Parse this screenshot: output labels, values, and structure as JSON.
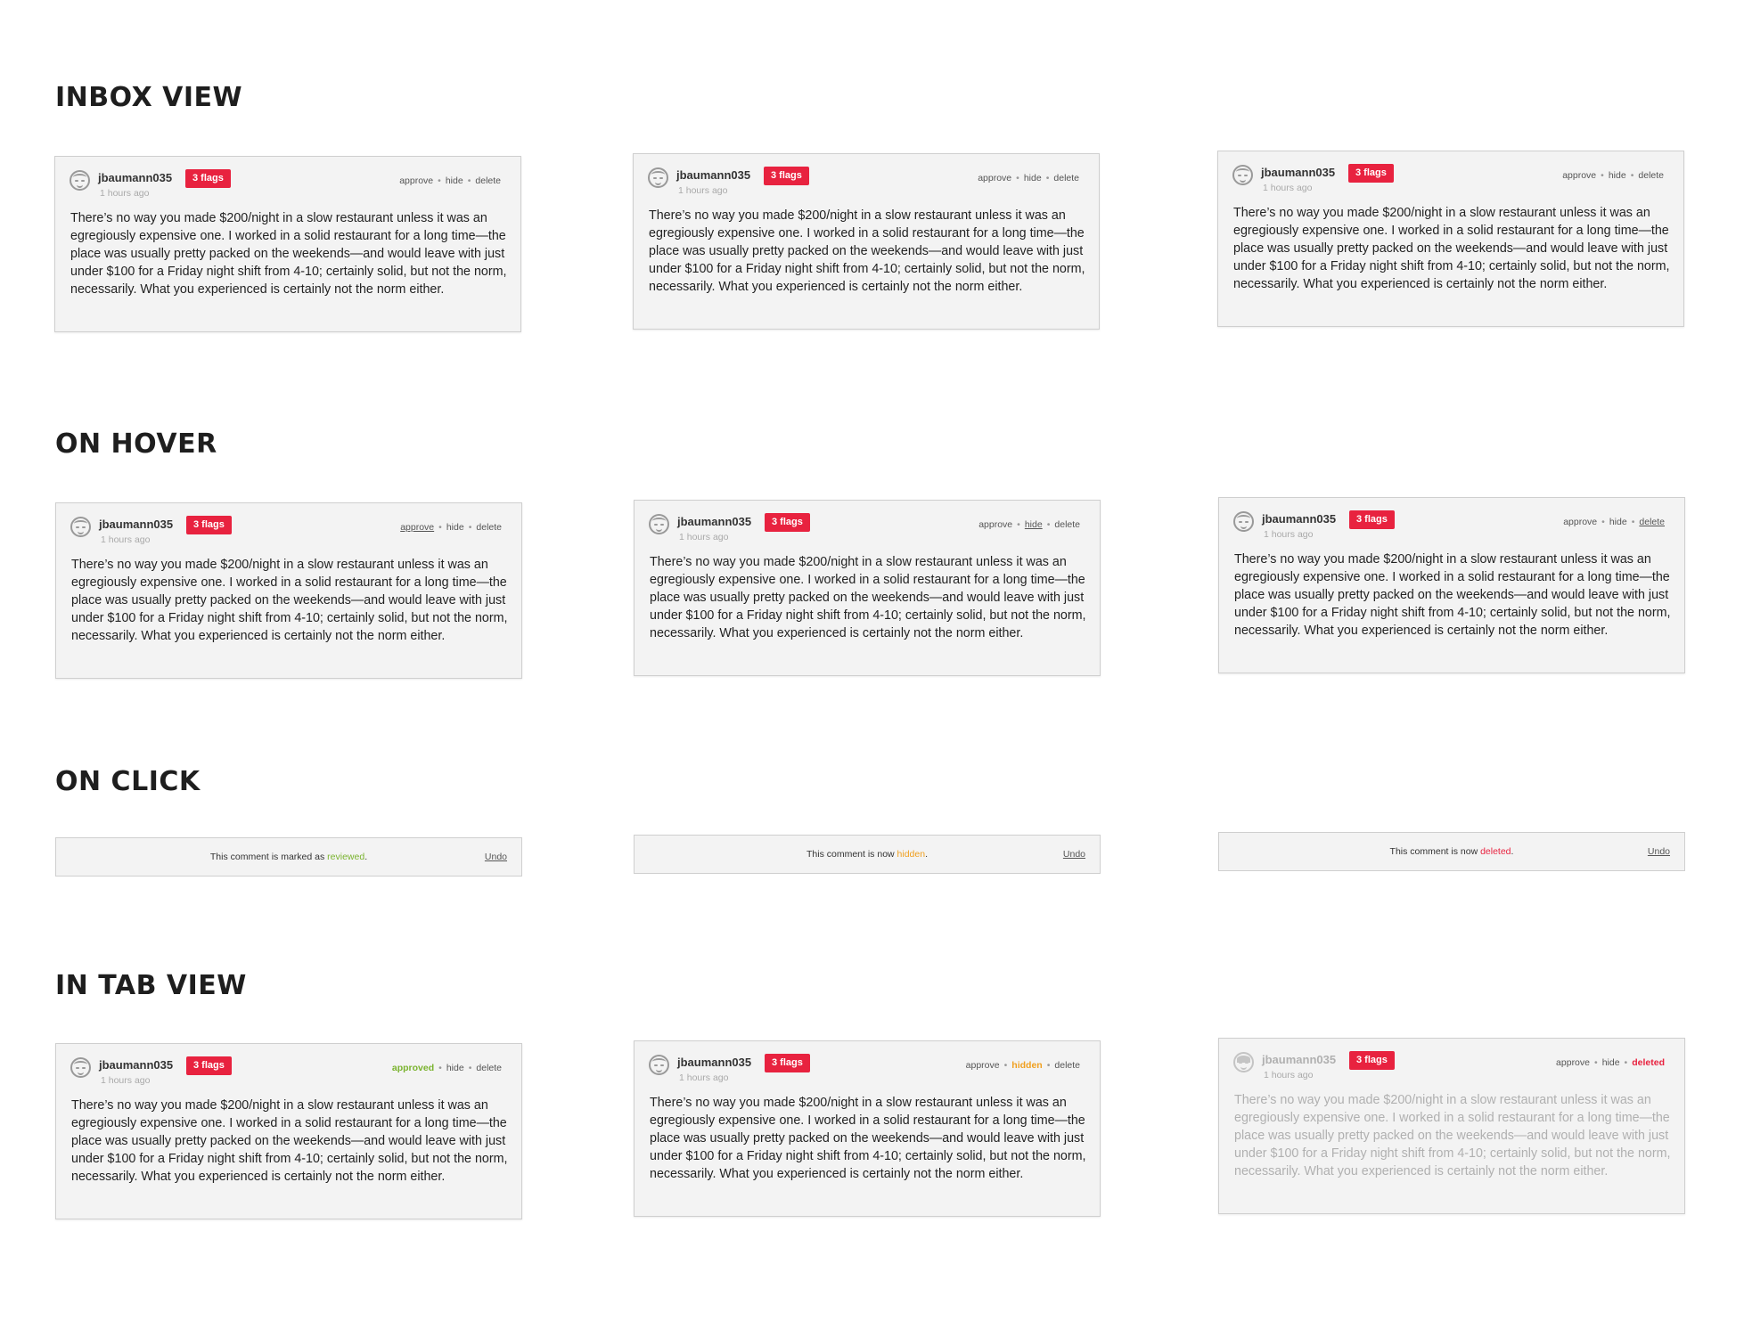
{
  "sections": {
    "inbox": "INBOX VIEW",
    "hover": "ON HOVER",
    "click": "ON CLICK",
    "tab": "IN TAB VIEW"
  },
  "comment": {
    "username": "jbaumann035",
    "flags": "3 flags",
    "time": "1 hours ago",
    "body": "There’s no way you made $200/night in a slow restaurant unless it was an egregiously expensive one. I worked in a solid restaurant for a long time—the place was usually pretty packed on the weekends—and would leave with just under $100 for a Friday night shift from 4-10; certainly solid, but not the norm, necessarily. What you experienced is certainly not the norm either."
  },
  "actions": {
    "approve": "approve",
    "hide": "hide",
    "delete": "delete",
    "separator": "•",
    "approved": "approved",
    "hidden": "hidden",
    "deleted": "deleted"
  },
  "notices": {
    "reviewed": {
      "prefix": "This comment is marked as ",
      "status": "reviewed",
      "suffix": "."
    },
    "hidden": {
      "prefix": "This comment is now ",
      "status": "hidden",
      "suffix": "."
    },
    "deleted": {
      "prefix": "This comment is now ",
      "status": "deleted",
      "suffix": "."
    },
    "undo": "Undo"
  },
  "colors": {
    "flag_badge": "#e8223f",
    "approved": "#7ab32e",
    "hidden": "#f0a020",
    "deleted": "#e8223f",
    "card_bg": "#f3f3f3"
  }
}
